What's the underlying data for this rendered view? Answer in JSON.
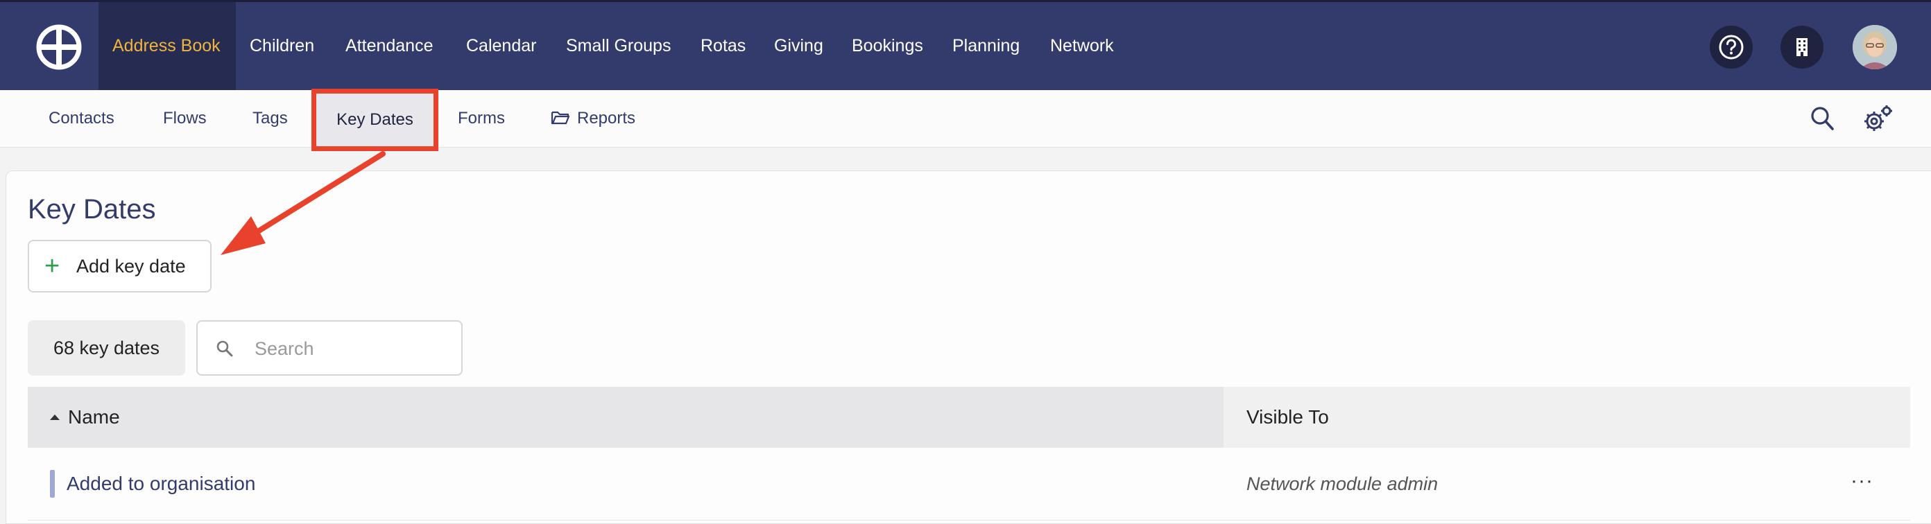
{
  "topnav": {
    "items": [
      {
        "label": "Address Book",
        "active": true
      },
      {
        "label": "Children"
      },
      {
        "label": "Attendance"
      },
      {
        "label": "Calendar"
      },
      {
        "label": "Small Groups"
      },
      {
        "label": "Rotas"
      },
      {
        "label": "Giving"
      },
      {
        "label": "Bookings"
      },
      {
        "label": "Planning"
      },
      {
        "label": "Network"
      }
    ],
    "icons": [
      "help-icon",
      "building-icon"
    ],
    "colors": {
      "bar": "#333b6c",
      "active_text": "#f0b43a"
    }
  },
  "subnav": {
    "items": [
      {
        "label": "Contacts"
      },
      {
        "label": "Flows"
      },
      {
        "label": "Tags"
      },
      {
        "label": "Key Dates",
        "active": true
      },
      {
        "label": "Forms"
      },
      {
        "label": "Reports",
        "icon": "folder-icon"
      }
    ],
    "icons": [
      "search-icon",
      "settings-gear-icon"
    ]
  },
  "page": {
    "title": "Key Dates",
    "add_button": "Add key date",
    "count_label": "68 key dates",
    "search_placeholder": "Search"
  },
  "table": {
    "columns": [
      "Name",
      "Visible To"
    ],
    "sort": {
      "column": "Name",
      "direction": "ascending"
    },
    "rows": [
      {
        "name": "Added to organisation",
        "visible_to": "Network module admin",
        "actions": "···"
      }
    ]
  },
  "annotation": {
    "color": "#e8412c",
    "highlight": "Key Dates"
  }
}
